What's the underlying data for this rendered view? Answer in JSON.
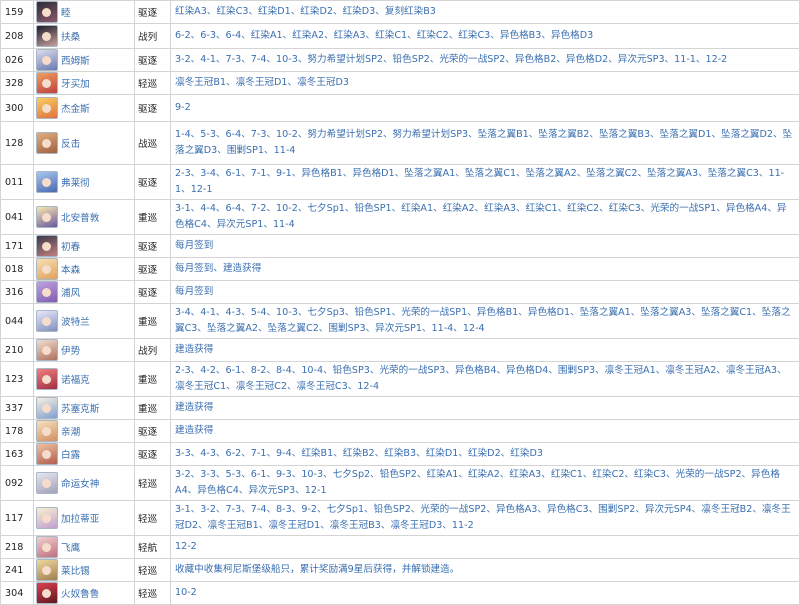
{
  "rows": [
    {
      "num": "159",
      "name": "睦",
      "type": "驱逐",
      "loc": "红染A3、红染C3、红染D1、红染D2、红染D3、复刻红染B3",
      "c1": "#2c2c3a",
      "c2": "#8b5a6a"
    },
    {
      "num": "208",
      "name": "扶桑",
      "type": "战列",
      "loc": "6-2、6-3、6-4、红染A1、红染A2、红染A3、红染C1、红染C2、红染C3、异色格B3、异色格D3",
      "c1": "#1e1e2a",
      "c2": "#c8a0a0"
    },
    {
      "num": "026",
      "name": "西姆斯",
      "type": "驱逐",
      "loc": "3-2、4-1、7-3、7-4、10-3、努力希望计划SP2、铅色SP2、光荣的一战SP2、异色格B2、异色格D2、异次元SP3、11-1、12-2",
      "c1": "#dcdcec",
      "c2": "#6a7ab0"
    },
    {
      "num": "328",
      "name": "牙买加",
      "type": "轻巡",
      "loc": "凛冬王冠B1、凛冬王冠D1、凛冬王冠D3",
      "c1": "#f0a060",
      "c2": "#c04040"
    },
    {
      "num": "300",
      "name": "杰金斯",
      "type": "驱逐",
      "loc": "9-2",
      "c1": "#f8d060",
      "c2": "#e07040"
    },
    {
      "num": "128",
      "name": "反击",
      "type": "战巡",
      "loc": "1-4、5-3、6-4、7-3、10-2、努力希望计划SP2、努力希望计划SP3、坠落之翼B1、坠落之翼B2、坠落之翼B3、坠落之翼D1、坠落之翼D2、坠落之翼D3、围剿SP1、11-4",
      "c1": "#e0b080",
      "c2": "#a06040"
    },
    {
      "num": "011",
      "name": "弗莱彻",
      "type": "驱逐",
      "loc": "2-3、3-4、6-1、7-1、9-1、异色格B1、异色格D1、坠落之翼A1、坠落之翼C1、坠落之翼A2、坠落之翼C2、坠落之翼A3、坠落之翼C3、11-1、12-1",
      "c1": "#a8c8f0",
      "c2": "#4a6ab0"
    },
    {
      "num": "041",
      "name": "北安普敦",
      "type": "重巡",
      "loc": "3-1、4-4、6-4、7-2、10-2、七夕Sp1、铅色SP1、红染A1、红染A2、红染A3、红染C1、红染C2、红染C3、光荣的一战SP1、异色格A4、异色格C4、异次元SP1、11-4",
      "c1": "#f8e8b0",
      "c2": "#6a5aa0"
    },
    {
      "num": "171",
      "name": "初春",
      "type": "驱逐",
      "loc": "每月签到",
      "c1": "#3a3a4a",
      "c2": "#c08080"
    },
    {
      "num": "018",
      "name": "本森",
      "type": "驱逐",
      "loc": "每月签到、建造获得",
      "c1": "#f8e0b0",
      "c2": "#e0a060"
    },
    {
      "num": "316",
      "name": "浦风",
      "type": "驱逐",
      "loc": "每月签到",
      "c1": "#c0a0e0",
      "c2": "#8060b0"
    },
    {
      "num": "044",
      "name": "波特兰",
      "type": "重巡",
      "loc": "3-4、4-1、4-3、5-4、10-3、七夕Sp3、铅色SP1、光荣的一战SP1、异色格B1、异色格D1、坠落之翼A1、坠落之翼A3、坠落之翼C1、坠落之翼C3、坠落之翼A2、坠落之翼C2、围剿SP3、异次元SP1、11-4、12-4",
      "c1": "#e8e8f8",
      "c2": "#8090c0"
    },
    {
      "num": "210",
      "name": "伊势",
      "type": "战列",
      "loc": "建造获得",
      "c1": "#f0e0d0",
      "c2": "#b07060"
    },
    {
      "num": "123",
      "name": "诺福克",
      "type": "重巡",
      "loc": "2-3、4-2、6-1、8-2、8-4、10-4、铅色SP3、光荣的一战SP3、异色格B4、异色格D4、围剿SP3、凛冬王冠A1、凛冬王冠A2、凛冬王冠A3、凛冬王冠C1、凛冬王冠C2、凛冬王冠C3、12-4",
      "c1": "#f08080",
      "c2": "#a03040"
    },
    {
      "num": "337",
      "name": "苏塞克斯",
      "type": "重巡",
      "loc": "建造获得",
      "c1": "#f8f0e0",
      "c2": "#80a0d0"
    },
    {
      "num": "178",
      "name": "亲潮",
      "type": "驱逐",
      "loc": "建造获得",
      "c1": "#f8e0c0",
      "c2": "#d09060"
    },
    {
      "num": "163",
      "name": "白露",
      "type": "驱逐",
      "loc": "3-3、4-3、6-2、7-1、9-4、红染B1、红染B2、红染B3、红染D1、红染D2、红染D3",
      "c1": "#f0c0a0",
      "c2": "#b06050"
    },
    {
      "num": "092",
      "name": "命运女神",
      "type": "轻巡",
      "loc": "3-2、3-3、5-3、6-1、9-3、10-3、七夕Sp2、铅色SP2、红染A1、红染A2、红染A3、红染C1、红染C2、红染C3、光荣的一战SP2、异色格A4、异色格C4、异次元SP3、12-1",
      "c1": "#e8e8f0",
      "c2": "#a0a0b8"
    },
    {
      "num": "117",
      "name": "加拉蒂亚",
      "type": "轻巡",
      "loc": "3-1、3-2、7-3、7-4、8-3、9-2、七夕Sp1、铅色SP2、光荣的一战SP2、异色格A3、异色格C3、围剿SP2、异次元SP4、凛冬王冠B2、凛冬王冠D2、凛冬王冠B1、凛冬王冠D1、凛冬王冠B3、凛冬王冠D3、11-2",
      "c1": "#f8f0d0",
      "c2": "#c0a0d0"
    },
    {
      "num": "218",
      "name": "飞鹰",
      "type": "轻航",
      "loc": "12-2",
      "c1": "#f0d0d0",
      "c2": "#c07080"
    },
    {
      "num": "241",
      "name": "莱比锡",
      "type": "轻巡",
      "loc": "收藏中收集柯尼斯堡级船只，累计奖励满9星后获得，并解锁建造。",
      "c1": "#f0d8a0",
      "c2": "#a08050"
    },
    {
      "num": "304",
      "name": "火奴鲁鲁",
      "type": "轻巡",
      "loc": "10-2",
      "c1": "#e04050",
      "c2": "#601820"
    }
  ]
}
